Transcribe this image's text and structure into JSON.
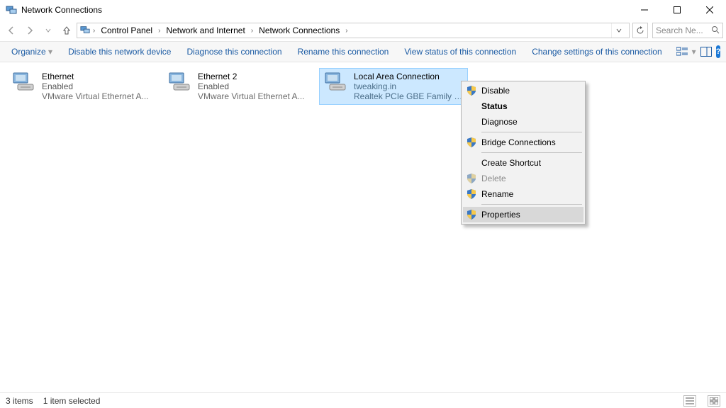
{
  "title": "Network Connections",
  "breadcrumbs": [
    "Control Panel",
    "Network and Internet",
    "Network Connections"
  ],
  "search_placeholder": "Search Ne...",
  "command_bar": {
    "organize": "Organize",
    "c1": "Disable this network device",
    "c2": "Diagnose this connection",
    "c3": "Rename this connection",
    "c4": "View status of this connection",
    "c5": "Change settings of this connection"
  },
  "connections": [
    {
      "name": "Ethernet",
      "status": "Enabled",
      "desc": "VMware Virtual Ethernet A..."
    },
    {
      "name": "Ethernet 2",
      "status": "Enabled",
      "desc": "VMware Virtual Ethernet A..."
    },
    {
      "name": "Local Area Connection",
      "status": "tweaking.in",
      "desc": "Realtek PCIe GBE Family C..."
    }
  ],
  "context_menu": {
    "disable": "Disable",
    "status": "Status",
    "diagnose": "Diagnose",
    "bridge": "Bridge Connections",
    "shortcut": "Create Shortcut",
    "delete": "Delete",
    "rename": "Rename",
    "properties": "Properties"
  },
  "status_bar": {
    "count": "3 items",
    "selected": "1 item selected"
  }
}
